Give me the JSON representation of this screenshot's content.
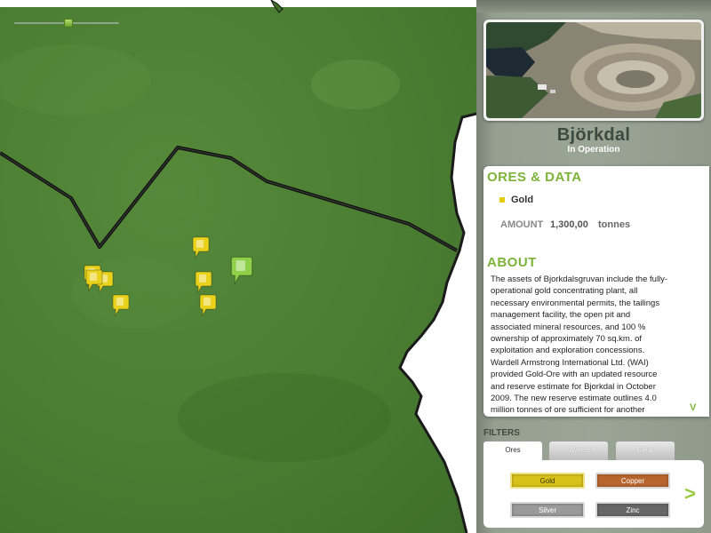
{
  "site": {
    "name": "Björkdal",
    "status": "In Operation"
  },
  "ores_section": {
    "title": "ORES & DATA",
    "ore_name": "Gold",
    "ore_color": "#e3cf10",
    "amount_label": "AMOUNT",
    "amount_value": "1,300,00",
    "amount_unit": "tonnes"
  },
  "about_section": {
    "title": "ABOUT",
    "text": "The assets of Bjorkdalsgruvan include the fully-operational gold concentrating plant, all necessary environmental permits, the tailings management facility, the open pit and associated mineral resources, and 100 % ownership of approximately 70 sq.km. of exploitation and exploration concessions. Wardell Armstrong International Ltd. (WAI) provided Gold-Ore with an updated resource and reserve estimate for Bjorkdal in October 2009. The new reserve estimate outlines 4.0 million tonnes of ore sufficient for another",
    "scroll_glyph": "V"
  },
  "filters": {
    "label": "FILTERS",
    "tabs": [
      "Ores",
      "Owners",
      "Clear"
    ],
    "active_tab": "Ores",
    "ore_buttons": [
      {
        "label": "Gold",
        "color": "#d8c21a"
      },
      {
        "label": "Copper",
        "color": "#b8652e"
      },
      {
        "label": "Silver",
        "color": "#9a9a9a"
      },
      {
        "label": "Zinc",
        "color": "#666666"
      }
    ],
    "next_glyph": ">"
  },
  "map": {
    "zoom_level": 0.5,
    "marker_colors": {
      "selected": "#8fd04a",
      "gold": "#e9d21c"
    },
    "markers": [
      "gold",
      "gold",
      "gold",
      "gold",
      "gold",
      "gold",
      "gold",
      "selected"
    ]
  },
  "colors": {
    "accent": "#7db33a",
    "panel": "#9aa596",
    "land": "#4b7d32"
  }
}
